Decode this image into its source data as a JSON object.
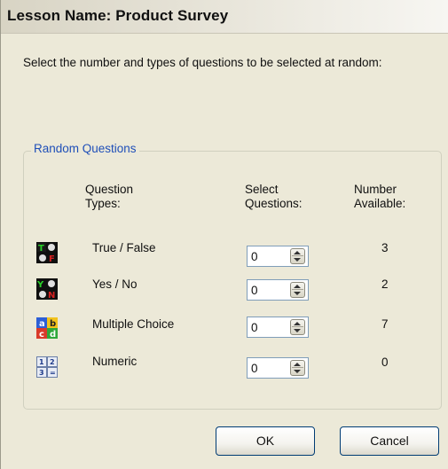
{
  "dialog": {
    "title": "Lesson Name: Product Survey",
    "instruction": "Select the number and types of questions to be selected at random:"
  },
  "group": {
    "legend": "Random Questions",
    "headers": {
      "types_line1": "Question",
      "types_line2": "Types:",
      "select_line1": "Select",
      "select_line2": "Questions:",
      "available_line1": "Number",
      "available_line2": "Available:"
    },
    "rows": [
      {
        "icon": "true-false-icon",
        "label": "True / False",
        "value": "0",
        "available": "3"
      },
      {
        "icon": "yes-no-icon",
        "label": "Yes / No",
        "value": "0",
        "available": "2"
      },
      {
        "icon": "multiple-choice-icon",
        "label": "Multiple Choice",
        "value": "0",
        "available": "7"
      },
      {
        "icon": "numeric-icon",
        "label": "Numeric",
        "value": "0",
        "available": "0"
      }
    ]
  },
  "buttons": {
    "ok": "OK",
    "cancel": "Cancel"
  }
}
